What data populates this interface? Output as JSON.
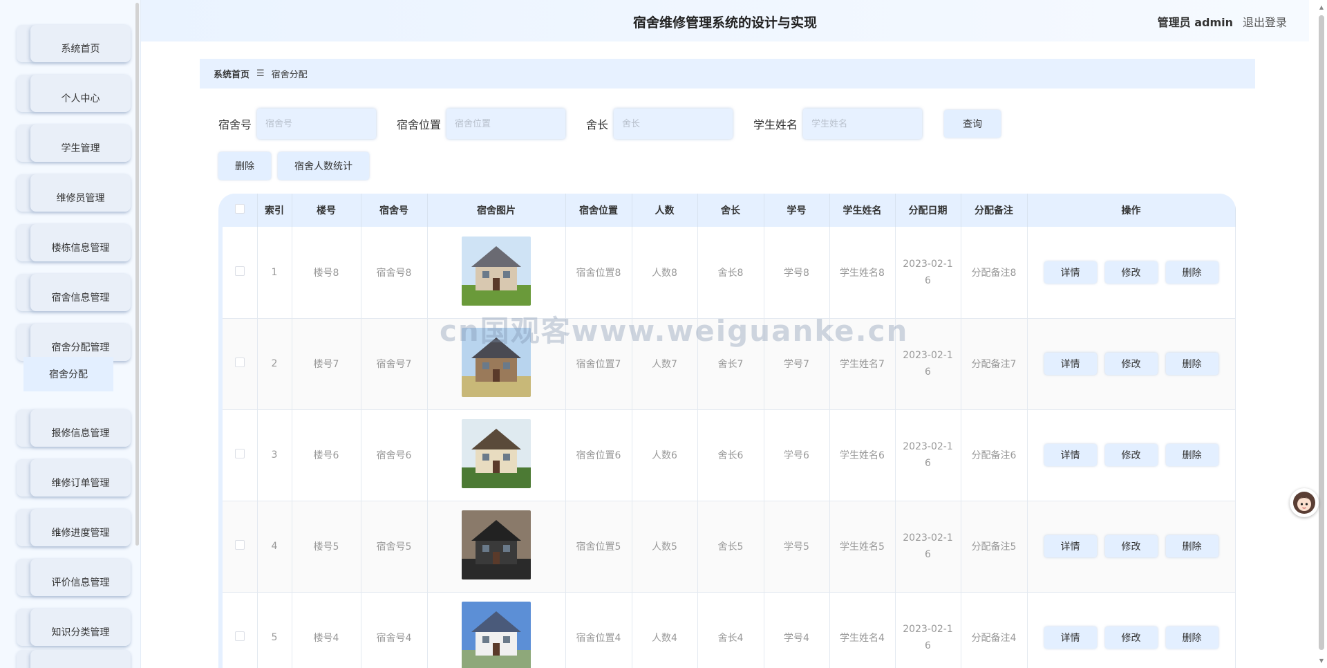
{
  "header": {
    "title": "宿舍维修管理系统的设计与实现",
    "user": "管理员 admin",
    "logout": "退出登录"
  },
  "sidebar": {
    "items": [
      "系统首页",
      "个人中心",
      "学生管理",
      "维修员管理",
      "楼栋信息管理",
      "宿舍信息管理",
      "宿舍分配管理",
      "报修信息管理",
      "维修订单管理",
      "维修进度管理",
      "评价信息管理",
      "知识分类管理"
    ],
    "submenu": "宿舍分配"
  },
  "breadcrumb": {
    "home": "系统首页",
    "separator": "☰",
    "current": "宿舍分配"
  },
  "search": {
    "fields": [
      {
        "label": "宿舍号",
        "placeholder": "宿舍号"
      },
      {
        "label": "宿舍位置",
        "placeholder": "宿舍位置"
      },
      {
        "label": "舍长",
        "placeholder": "舍长"
      },
      {
        "label": "学生姓名",
        "placeholder": "学生姓名"
      }
    ],
    "query_button": "查询"
  },
  "actions": {
    "delete": "删除",
    "stats": "宿舍人数统计"
  },
  "table": {
    "headers": [
      "索引",
      "楼号",
      "宿舍号",
      "宿舍图片",
      "宿舍位置",
      "人数",
      "舍长",
      "学号",
      "学生姓名",
      "分配日期",
      "分配备注",
      "操作"
    ],
    "op_labels": {
      "detail": "详情",
      "edit": "修改",
      "delete": "删除"
    },
    "rows": [
      {
        "index": "1",
        "building": "楼号8",
        "room": "宿舍号8",
        "location": "宿舍位置8",
        "count": "人数8",
        "leader": "舍长8",
        "sid": "学号8",
        "name": "学生姓名8",
        "date_a": "2023-02-1",
        "date_b": "6",
        "note": "分配备注8"
      },
      {
        "index": "2",
        "building": "楼号7",
        "room": "宿舍号7",
        "location": "宿舍位置7",
        "count": "人数7",
        "leader": "舍长7",
        "sid": "学号7",
        "name": "学生姓名7",
        "date_a": "2023-02-1",
        "date_b": "6",
        "note": "分配备注7"
      },
      {
        "index": "3",
        "building": "楼号6",
        "room": "宿舍号6",
        "location": "宿舍位置6",
        "count": "人数6",
        "leader": "舍长6",
        "sid": "学号6",
        "name": "学生姓名6",
        "date_a": "2023-02-1",
        "date_b": "6",
        "note": "分配备注6"
      },
      {
        "index": "4",
        "building": "楼号5",
        "room": "宿舍号5",
        "location": "宿舍位置5",
        "count": "人数5",
        "leader": "舍长5",
        "sid": "学号5",
        "name": "学生姓名5",
        "date_a": "2023-02-1",
        "date_b": "6",
        "note": "分配备注5"
      },
      {
        "index": "5",
        "building": "楼号4",
        "room": "宿舍号4",
        "location": "宿舍位置4",
        "count": "人数4",
        "leader": "舍长4",
        "sid": "学号4",
        "name": "学生姓名4",
        "date_a": "2023-02-1",
        "date_b": "6",
        "note": "分配备注4"
      }
    ]
  },
  "watermark": "cn国观客www.weiguanke.cn"
}
